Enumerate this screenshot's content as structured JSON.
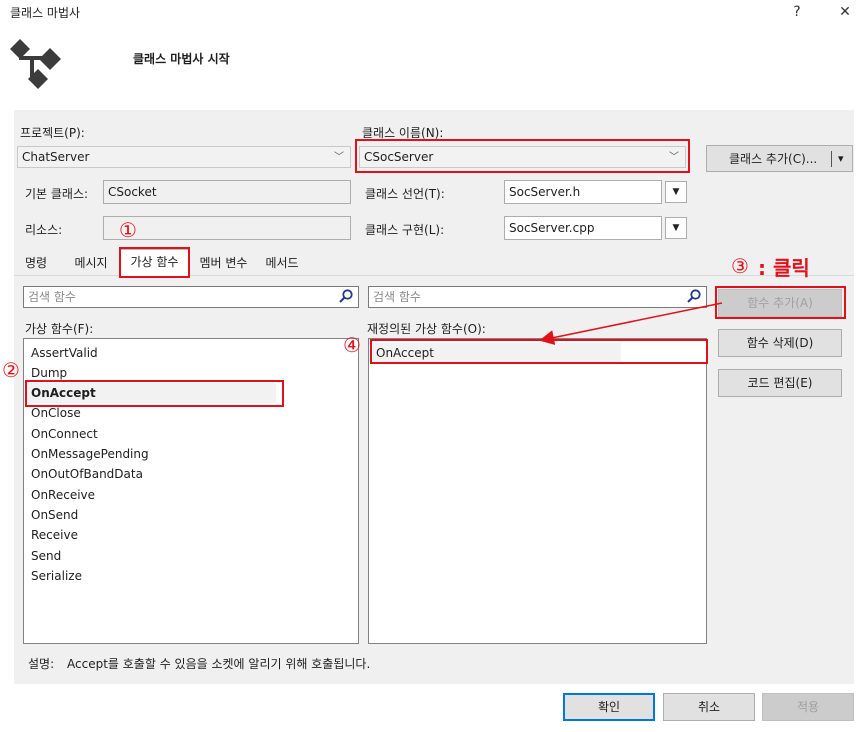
{
  "window": {
    "title": "클래스 마법사",
    "help": "?",
    "close": "✕"
  },
  "banner": {
    "heading": "클래스 마법사 시작"
  },
  "project": {
    "label": "프로젝트(P):",
    "value": "ChatServer"
  },
  "class_name": {
    "label": "클래스 이름(N):",
    "value": "CSocServer"
  },
  "add_class_button": {
    "label": "클래스 추가(C)...",
    "arrow": "▾"
  },
  "base_class": {
    "label": "기본 클래스:",
    "value": "CSocket"
  },
  "resource": {
    "label": "리소스:",
    "value": ""
  },
  "class_decl": {
    "label": "클래스 선언(T):",
    "value": "SocServer.h"
  },
  "class_impl": {
    "label": "클래스 구현(L):",
    "value": "SocServer.cpp"
  },
  "tabs": [
    "명령",
    "메시지",
    "가상 함수",
    "멤버 변수",
    "메서드"
  ],
  "search_left": {
    "placeholder": "검색 함수"
  },
  "search_right": {
    "placeholder": "검색 함수"
  },
  "virtual_functions": {
    "label": "가상 함수(F):",
    "items": [
      "AssertValid",
      "Dump",
      "OnAccept",
      "OnClose",
      "OnConnect",
      "OnMessagePending",
      "OnOutOfBandData",
      "OnReceive",
      "OnSend",
      "Receive",
      "Send",
      "Serialize"
    ],
    "selected": "OnAccept"
  },
  "overridden": {
    "label": "재정의된 가상 함수(O):",
    "items": [
      "OnAccept"
    ]
  },
  "buttons": {
    "add_function": "함수 추가(A)",
    "delete_function": "함수 삭제(D)",
    "edit_code": "코드 편집(E)"
  },
  "description": {
    "label": "설명:",
    "text": "Accept를 호출할 수 있음을 소켓에 알리기 위해 호출됩니다."
  },
  "footer": {
    "ok": "확인",
    "cancel": "취소",
    "apply": "적용"
  },
  "annotations": {
    "n1": "①",
    "n2": "②",
    "n3": "③",
    "n3_text": ": 클릭",
    "n4": "④"
  },
  "colors": {
    "annotation_red": "#e0111b",
    "accent": "#0078d7"
  }
}
